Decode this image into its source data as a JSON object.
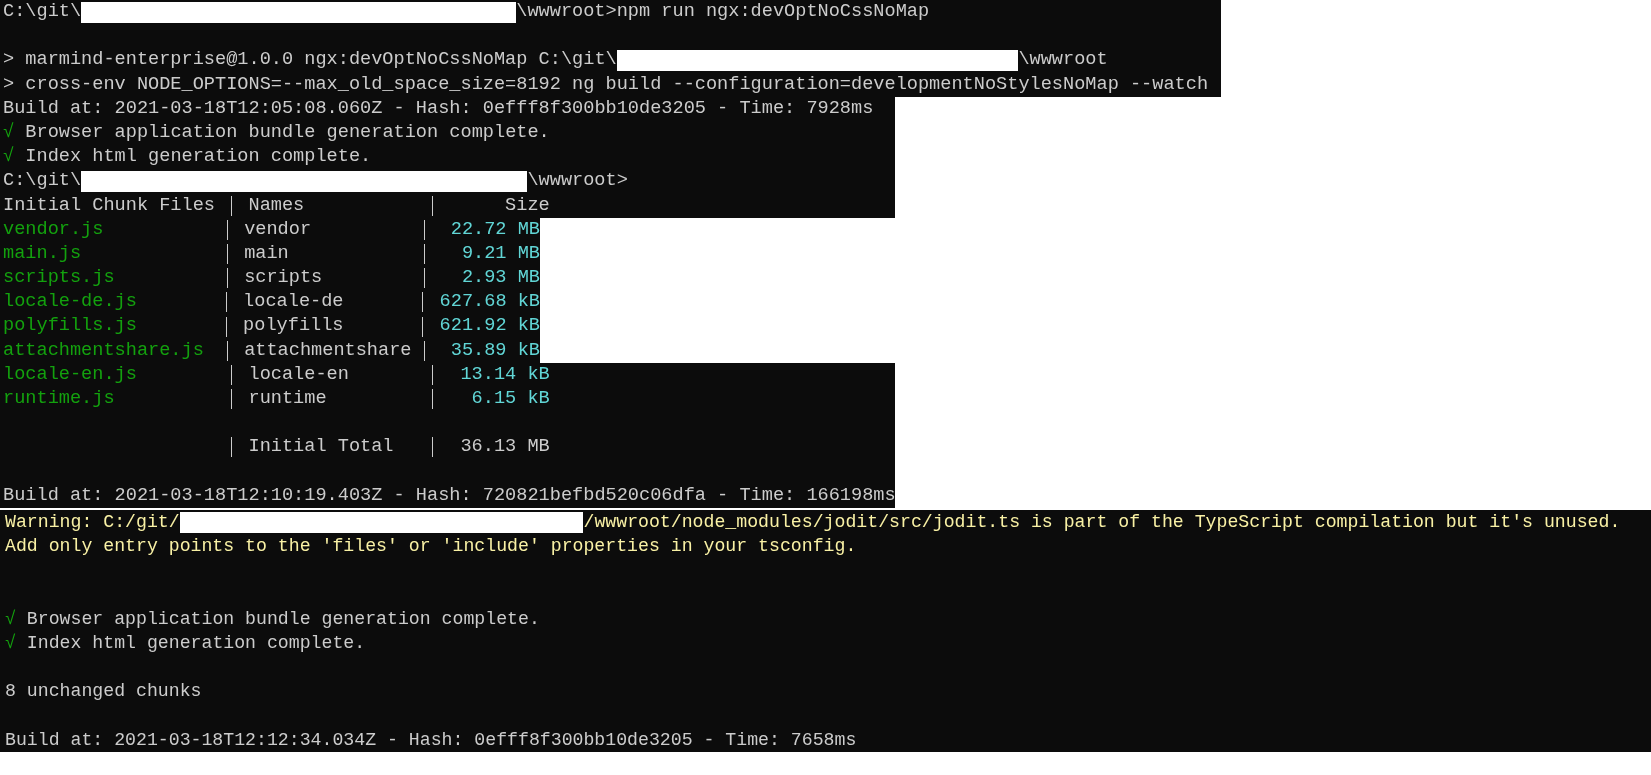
{
  "panels": [
    {
      "lines": [
        {
          "kind": "text",
          "parts": [
            {
              "kind": "text",
              "text": "C:\\git\\"
            },
            {
              "kind": "redaction"
            },
            {
              "kind": "text",
              "text": "\\wwwroot>npm run ngx:devOptNoCssNoMap"
            }
          ]
        },
        {
          "kind": "blank"
        },
        {
          "kind": "text",
          "parts": [
            {
              "kind": "text",
              "text": "> marmind-enterprise@1.0.0 ngx:devOptNoCssNoMap C:\\git\\"
            },
            {
              "kind": "redaction"
            },
            {
              "kind": "text",
              "text": "\\wwwroot"
            }
          ]
        },
        {
          "kind": "text",
          "parts": [
            {
              "kind": "text",
              "text": "> cross-env NODE_OPTIONS=--max_old_space_size=8192 ng build --configuration=developmentNoStylesNoMap --watch"
            }
          ]
        }
      ]
    },
    {
      "lines": [
        {
          "kind": "text",
          "parts": [
            {
              "kind": "text",
              "text": "Build at: 2021-03-18T12:05:08.060Z - Hash: 0efff8f300bb10de3205 - Time: 7928ms"
            }
          ]
        },
        {
          "kind": "text",
          "parts": [
            {
              "kind": "symbol",
              "text": "√",
              "color": "#13a10e"
            },
            {
              "kind": "text",
              "text": " Browser application bundle generation complete."
            }
          ]
        },
        {
          "kind": "text",
          "parts": [
            {
              "kind": "symbol",
              "text": "√",
              "color": "#13a10e"
            },
            {
              "kind": "text",
              "text": " Index html generation complete."
            }
          ]
        },
        {
          "kind": "text",
          "parts": [
            {
              "kind": "text",
              "text": "C:\\git\\"
            },
            {
              "kind": "redaction"
            },
            {
              "kind": "text",
              "text": "\\wwwroot>"
            }
          ]
        },
        {
          "kind": "row",
          "header": true,
          "file": "Initial Chunk Files",
          "name": "Names",
          "size": "Size"
        }
      ]
    },
    {
      "lines": [
        {
          "kind": "row",
          "header": false,
          "file": "vendor.js",
          "name": "vendor",
          "size": "22.72 MB"
        },
        {
          "kind": "row",
          "header": false,
          "file": "main.js",
          "name": "main",
          "size": "9.21 MB"
        },
        {
          "kind": "row",
          "header": false,
          "file": "scripts.js",
          "name": "scripts",
          "size": "2.93 MB"
        },
        {
          "kind": "row",
          "header": false,
          "file": "locale-de.js",
          "name": "locale-de",
          "size": "627.68 kB"
        },
        {
          "kind": "row",
          "header": false,
          "file": "polyfills.js",
          "name": "polyfills",
          "size": "621.92 kB"
        },
        {
          "kind": "row",
          "header": false,
          "file": "attachmentshare.js",
          "name": "attachmentshare",
          "size": "35.89 kB"
        }
      ]
    },
    {
      "lines": [
        {
          "kind": "row",
          "header": false,
          "file": "locale-en.js",
          "name": "locale-en",
          "size": "13.14 kB"
        },
        {
          "kind": "row",
          "header": false,
          "file": "runtime.js",
          "name": "runtime",
          "size": "6.15 kB"
        },
        {
          "kind": "blank"
        },
        {
          "kind": "row",
          "header": true,
          "name": "Initial Total",
          "size": "36.13 MB"
        },
        {
          "kind": "blank"
        },
        {
          "kind": "text",
          "parts": [
            {
              "kind": "text",
              "text": "Build at: 2021-03-18T12:10:19.403Z - Hash: 720821befbd520c06dfa - Time: 166198ms"
            }
          ]
        }
      ]
    },
    {
      "lines": [
        {
          "kind": "text",
          "parts": [
            {
              "kind": "text",
              "text": "Warning: C:/git/",
              "color": "#f9f1a5"
            },
            {
              "kind": "redaction"
            },
            {
              "kind": "text",
              "text": "/wwwroot/node_modules/jodit/src/jodit.ts is part of the TypeScript compilation but it's unused.",
              "color": "#f9f1a5"
            }
          ]
        },
        {
          "kind": "text",
          "parts": [
            {
              "kind": "text",
              "text": "Add only entry points to the 'files' or 'include' properties in your tsconfig.",
              "color": "#f9f1a5"
            }
          ]
        },
        {
          "kind": "blank"
        },
        {
          "kind": "blank"
        },
        {
          "kind": "text",
          "parts": [
            {
              "kind": "symbol",
              "text": "√",
              "color": "#13a10e"
            },
            {
              "kind": "text",
              "text": " Browser application bundle generation complete."
            }
          ]
        },
        {
          "kind": "text",
          "parts": [
            {
              "kind": "symbol",
              "text": "√",
              "color": "#13a10e"
            },
            {
              "kind": "text",
              "text": " Index html generation complete."
            }
          ]
        },
        {
          "kind": "blank"
        },
        {
          "kind": "text",
          "parts": [
            {
              "kind": "text",
              "text": "8 unchanged chunks"
            }
          ]
        },
        {
          "kind": "blank"
        },
        {
          "kind": "text",
          "parts": [
            {
              "kind": "text",
              "text": "Build at: 2021-03-18T12:12:34.034Z - Hash: 0efff8f300bb10de3205 - Time: 7658ms"
            }
          ]
        }
      ]
    }
  ]
}
